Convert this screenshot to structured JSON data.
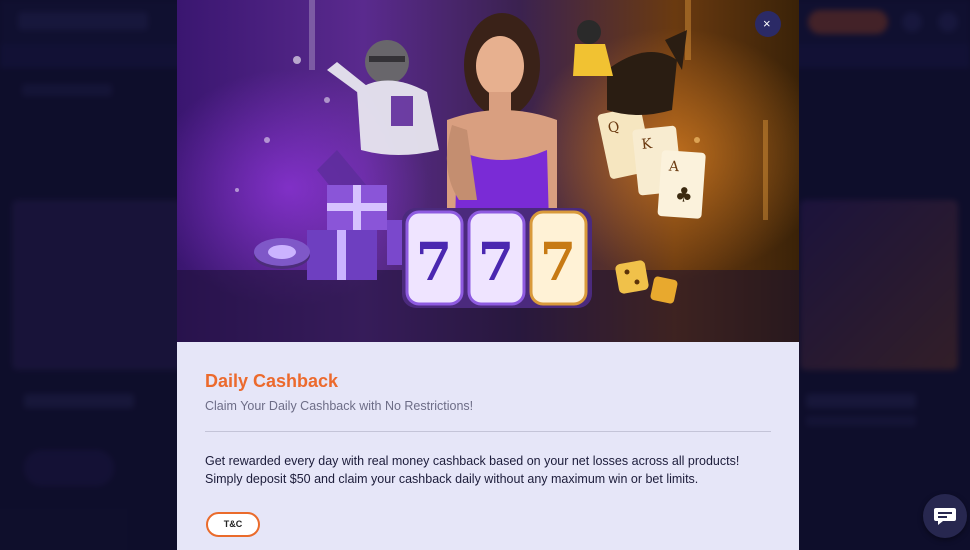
{
  "modal": {
    "close_symbol": "×",
    "hero_image": "casino-sports-promo-banner",
    "title": "Daily Cashback",
    "subtitle": "Claim Your Daily Cashback with No Restrictions!",
    "body": [
      "Get rewarded every day with real money cashback based on your net losses across all products!",
      "Simply deposit $50 and claim your cashback daily without any maximum win or bet limits."
    ],
    "tc_label": "T&C",
    "slot_reels": [
      "7",
      "7",
      "7"
    ]
  },
  "chat": {
    "icon": "chat-bubble-icon"
  },
  "colors": {
    "accent": "#ec6a2d",
    "modal_bg": "#e6e6f8",
    "page_bg": "#161536"
  }
}
